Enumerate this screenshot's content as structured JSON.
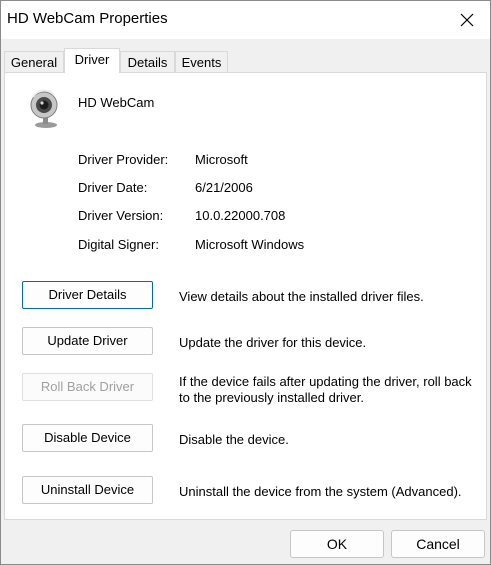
{
  "window": {
    "title": "HD WebCam Properties"
  },
  "tabs": [
    {
      "label": "General",
      "active": false
    },
    {
      "label": "Driver",
      "active": true
    },
    {
      "label": "Details",
      "active": false
    },
    {
      "label": "Events",
      "active": false
    }
  ],
  "device": {
    "name": "HD WebCam",
    "icon": "webcam-icon"
  },
  "properties": [
    {
      "label": "Driver Provider:",
      "value": "Microsoft"
    },
    {
      "label": "Driver Date:",
      "value": "6/21/2006"
    },
    {
      "label": "Driver Version:",
      "value": "10.0.22000.708"
    },
    {
      "label": "Digital Signer:",
      "value": "Microsoft Windows"
    }
  ],
  "actions": [
    {
      "label": "Driver Details",
      "description": "View details about the installed driver files.",
      "enabled": true,
      "focused": true
    },
    {
      "label": "Update Driver",
      "description": "Update the driver for this device.",
      "enabled": true,
      "focused": false
    },
    {
      "label": "Roll Back Driver",
      "description": "If the device fails after updating the driver, roll back to the previously installed driver.",
      "enabled": false,
      "focused": false
    },
    {
      "label": "Disable Device",
      "description": "Disable the device.",
      "enabled": true,
      "focused": false
    },
    {
      "label": "Uninstall Device",
      "description": "Uninstall the device from the system (Advanced).",
      "enabled": true,
      "focused": false
    }
  ],
  "footer": {
    "ok_label": "OK",
    "cancel_label": "Cancel"
  },
  "colors": {
    "focus_border": "#0067c0",
    "disabled_text": "#a0a0a0"
  }
}
